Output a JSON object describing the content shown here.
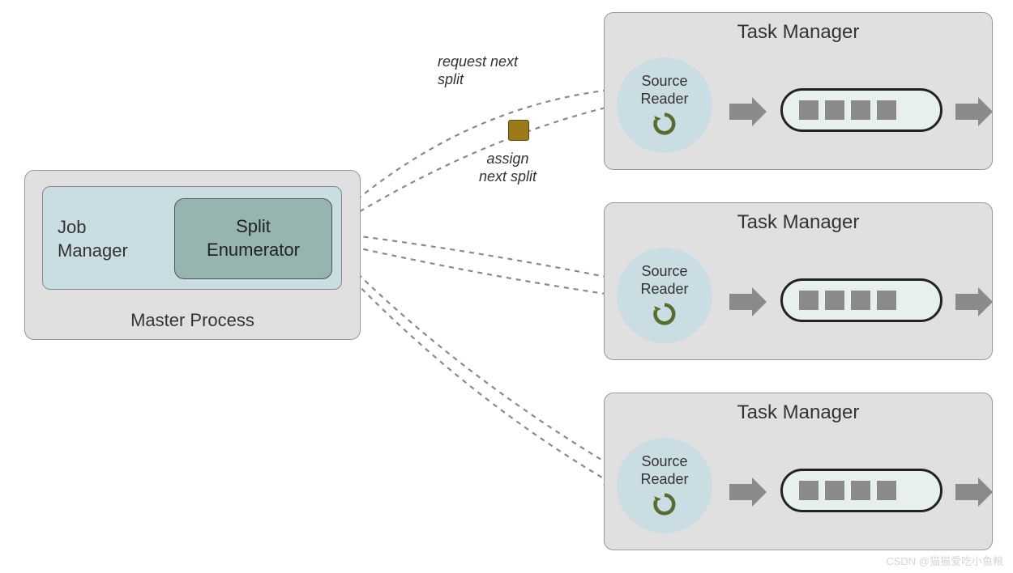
{
  "master": {
    "process_label": "Master Process",
    "job_manager_label": "Job\nManager",
    "split_enum_label": "Split\nEnumerator"
  },
  "task_managers": [
    {
      "label": "Task Manager",
      "reader_label": "Source\nReader"
    },
    {
      "label": "Task Manager",
      "reader_label": "Source\nReader"
    },
    {
      "label": "Task Manager",
      "reader_label": "Source\nReader"
    }
  ],
  "annotations": {
    "request": "request next\nsplit",
    "assign": "assign\nnext split"
  },
  "colors": {
    "box_bg": "#e0e0e0",
    "job_bg": "#c9dde2",
    "enum_bg": "#96b5b1",
    "arrow": "#8a8a8a",
    "refresh": "#5a6b2f",
    "split_square": "#9c7a1a"
  },
  "watermark": "CSDN @猫猫爱吃小鱼粮"
}
